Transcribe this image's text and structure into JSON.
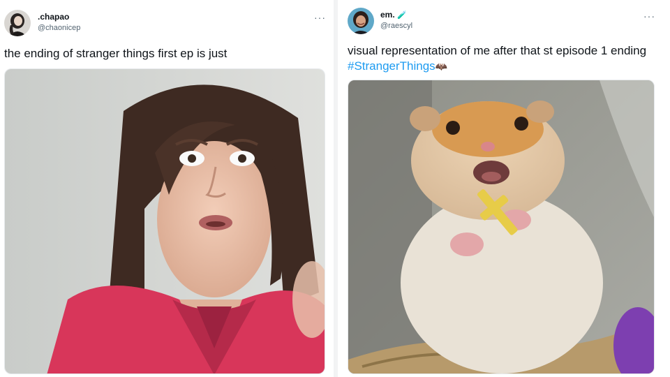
{
  "tweets": [
    {
      "display_name": ".chapao",
      "handle": "@chaonicep",
      "more_label": "···",
      "text": "the ending of stranger things first ep is just",
      "media_icon": "woman-shocked-reaction-image"
    },
    {
      "display_name": "em.",
      "name_emoji": "🧪",
      "handle": "@raescyl",
      "more_label": "···",
      "text_prefix": "visual representation of me after that st episode 1 ending ",
      "hashtag": "#StrangerThings",
      "hashtag_emoji": "🦇",
      "media_icon": "scared-hamster-holding-cross-image"
    }
  ],
  "colors": {
    "hashtag": "#1d9bf0",
    "secondary_text": "#536471",
    "divider": "#f2f3f4"
  }
}
